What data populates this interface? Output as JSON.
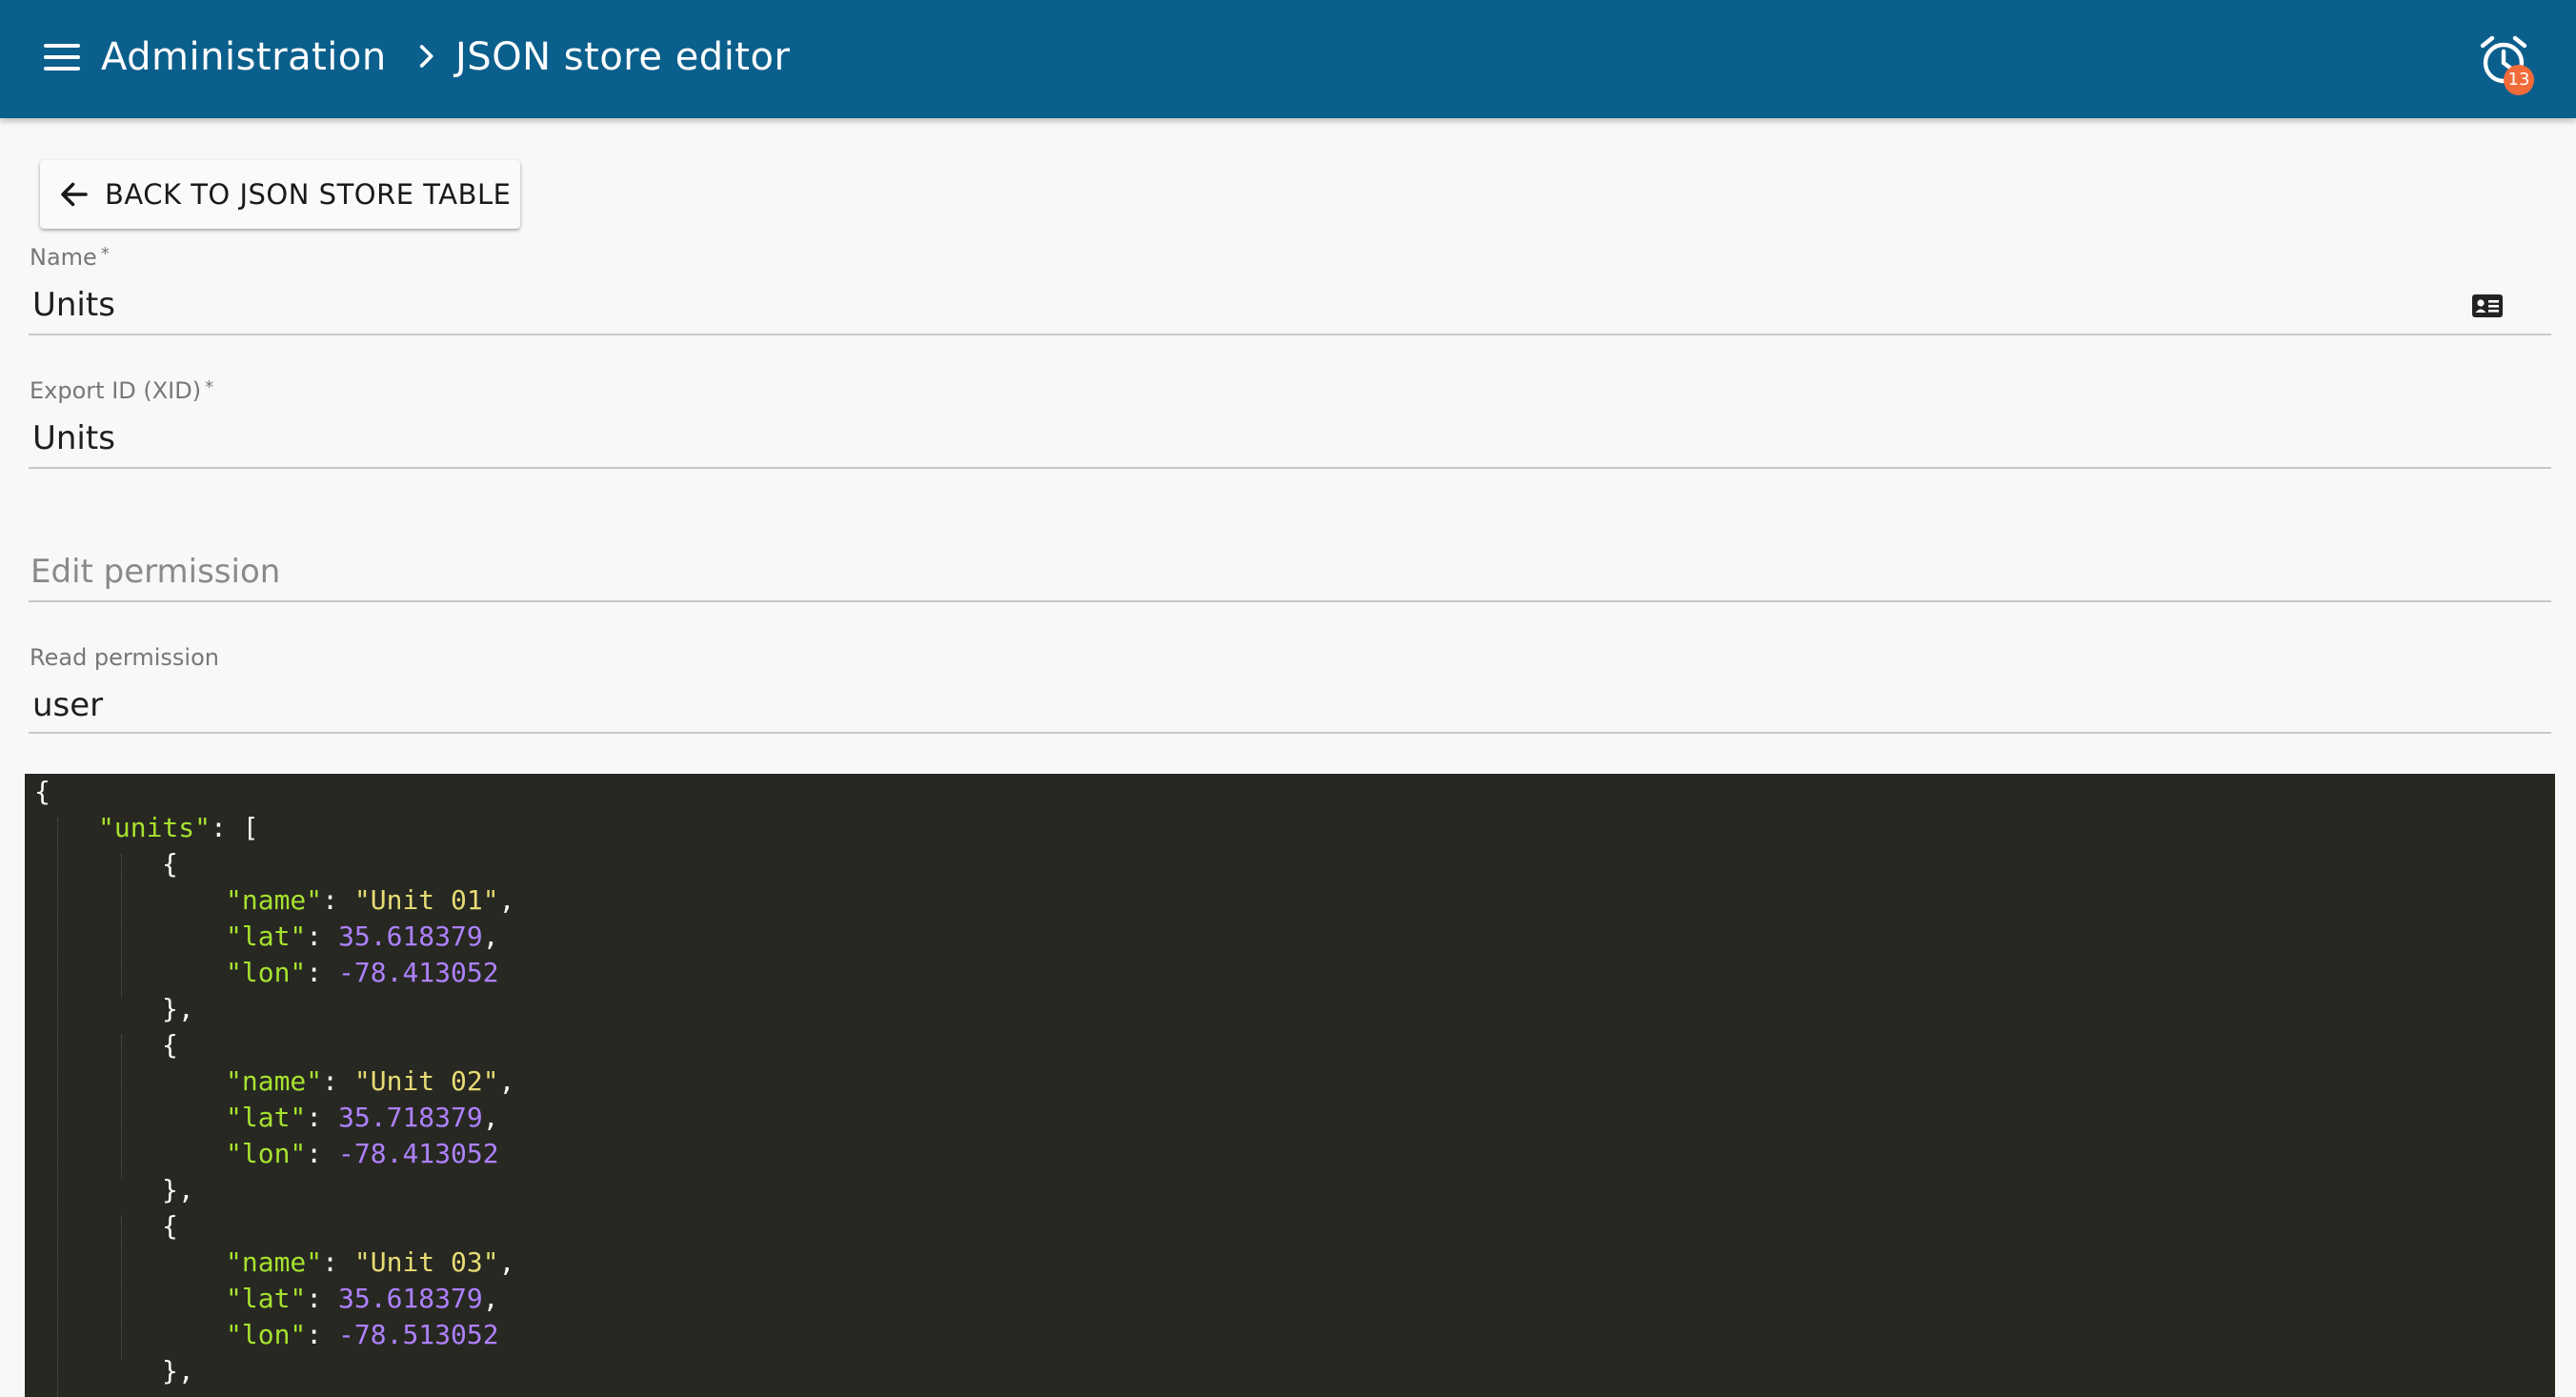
{
  "header": {
    "breadcrumb": [
      "Administration",
      "JSON store editor"
    ],
    "alarm_count": "13"
  },
  "back_button": {
    "label": "BACK TO JSON STORE TABLE"
  },
  "form": {
    "name": {
      "label": "Name",
      "required_marker": "*",
      "value": "Units"
    },
    "xid": {
      "label": "Export ID (XID)",
      "required_marker": "*",
      "value": "Units"
    },
    "edit_permission": {
      "label": "Edit permission",
      "value": ""
    },
    "read_permission": {
      "label": "Read permission",
      "value": "user"
    }
  },
  "editor": {
    "lines": [
      {
        "indent": 0,
        "tokens": [
          {
            "t": "p",
            "v": "{"
          }
        ]
      },
      {
        "indent": 1,
        "tokens": [
          {
            "t": "s",
            "v": "\"units\""
          },
          {
            "t": "p",
            "v": ": ["
          }
        ]
      },
      {
        "indent": 2,
        "tokens": [
          {
            "t": "p",
            "v": "{"
          }
        ]
      },
      {
        "indent": 3,
        "tokens": [
          {
            "t": "s",
            "v": "\"name\""
          },
          {
            "t": "p",
            "v": ": "
          },
          {
            "t": "s",
            "v": "\"Unit 01\""
          },
          {
            "t": "p",
            "v": ","
          }
        ]
      },
      {
        "indent": 3,
        "tokens": [
          {
            "t": "s",
            "v": "\"lat\""
          },
          {
            "t": "p",
            "v": ": "
          },
          {
            "t": "n",
            "v": "35.618379"
          },
          {
            "t": "p",
            "v": ","
          }
        ]
      },
      {
        "indent": 3,
        "tokens": [
          {
            "t": "s",
            "v": "\"lon\""
          },
          {
            "t": "p",
            "v": ": "
          },
          {
            "t": "n",
            "v": "-78.413052"
          }
        ]
      },
      {
        "indent": 2,
        "tokens": [
          {
            "t": "p",
            "v": "},"
          }
        ]
      },
      {
        "indent": 2,
        "tokens": [
          {
            "t": "p",
            "v": "{"
          }
        ]
      },
      {
        "indent": 3,
        "tokens": [
          {
            "t": "s",
            "v": "\"name\""
          },
          {
            "t": "p",
            "v": ": "
          },
          {
            "t": "s",
            "v": "\"Unit 02\""
          },
          {
            "t": "p",
            "v": ","
          }
        ]
      },
      {
        "indent": 3,
        "tokens": [
          {
            "t": "s",
            "v": "\"lat\""
          },
          {
            "t": "p",
            "v": ": "
          },
          {
            "t": "n",
            "v": "35.718379"
          },
          {
            "t": "p",
            "v": ","
          }
        ]
      },
      {
        "indent": 3,
        "tokens": [
          {
            "t": "s",
            "v": "\"lon\""
          },
          {
            "t": "p",
            "v": ": "
          },
          {
            "t": "n",
            "v": "-78.413052"
          }
        ]
      },
      {
        "indent": 2,
        "tokens": [
          {
            "t": "p",
            "v": "},"
          }
        ]
      },
      {
        "indent": 2,
        "tokens": [
          {
            "t": "p",
            "v": "{"
          }
        ]
      },
      {
        "indent": 3,
        "tokens": [
          {
            "t": "s",
            "v": "\"name\""
          },
          {
            "t": "p",
            "v": ": "
          },
          {
            "t": "s",
            "v": "\"Unit 03\""
          },
          {
            "t": "p",
            "v": ","
          }
        ]
      },
      {
        "indent": 3,
        "tokens": [
          {
            "t": "s",
            "v": "\"lat\""
          },
          {
            "t": "p",
            "v": ": "
          },
          {
            "t": "n",
            "v": "35.618379"
          },
          {
            "t": "p",
            "v": ","
          }
        ]
      },
      {
        "indent": 3,
        "tokens": [
          {
            "t": "s",
            "v": "\"lon\""
          },
          {
            "t": "p",
            "v": ": "
          },
          {
            "t": "n",
            "v": "-78.513052"
          }
        ]
      },
      {
        "indent": 2,
        "tokens": [
          {
            "t": "p",
            "v": "},"
          }
        ]
      }
    ]
  },
  "colors": {
    "toolbar": "#0b5f8c",
    "badge": "#f26b3a",
    "editor_bg": "#272822",
    "string": "#e6db74",
    "number": "#ae81ff"
  }
}
